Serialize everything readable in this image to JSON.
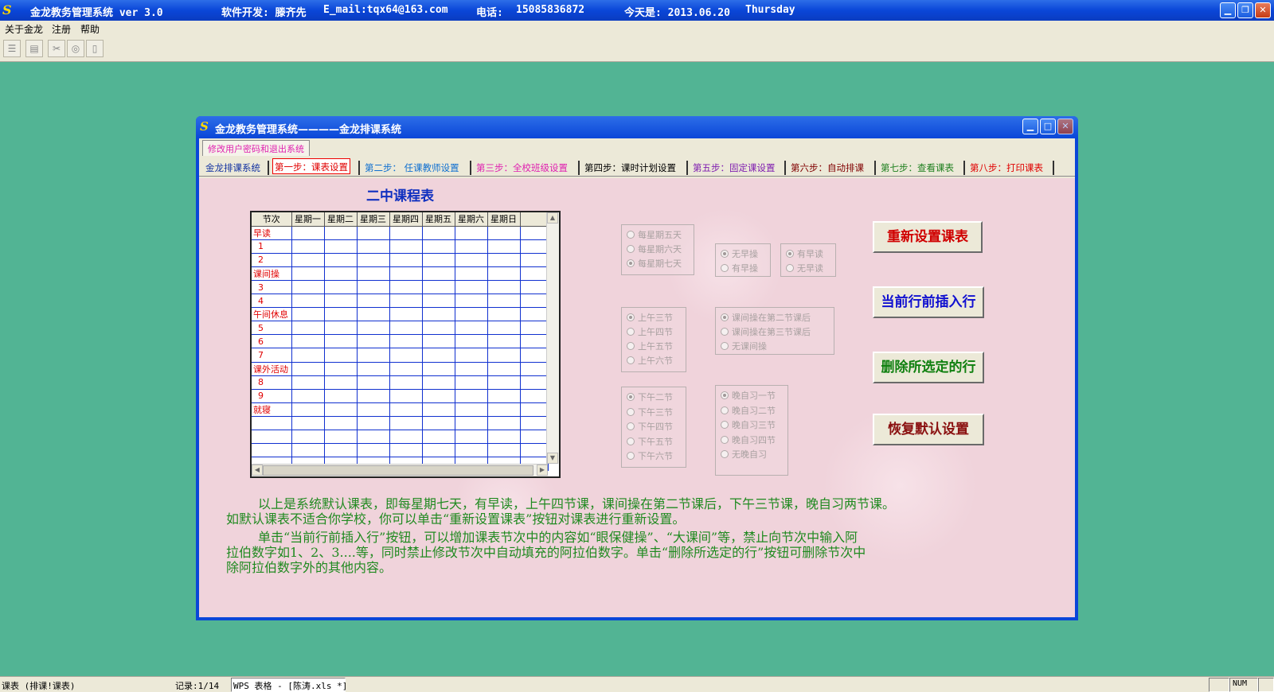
{
  "app": {
    "logo_letter": "S",
    "title": "金龙教务管理系统 ver 3.0",
    "developer": "软件开发: 滕齐先",
    "email": "E_mail:tqx64@163.com",
    "phone_label": "电话:",
    "phone": "15085836872",
    "date_label": "今天是: 2013.06.20",
    "weekday": "Thursday"
  },
  "menu": [
    "关于金龙",
    "注册",
    "帮助"
  ],
  "child_window": {
    "title": "金龙教务管理系统————金龙排课系统",
    "top_tab": "修改用户密码和退出系统",
    "tabs": [
      {
        "label": "金龙排课系统",
        "color": "#1030a0"
      },
      {
        "label": "第一步：课表设置",
        "color": "#e00000"
      },
      {
        "label": "第二步： 任课教师设置",
        "color": "#1070d0"
      },
      {
        "label": "第三步：全校班级设置",
        "color": "#e020b0"
      },
      {
        "label": "第四步：课时计划设置",
        "color": "#000000"
      },
      {
        "label": "第五步：固定课设置",
        "color": "#8020b0"
      },
      {
        "label": "第六步：自动排课",
        "color": "#800000"
      },
      {
        "label": "第七步：查看课表",
        "color": "#208020"
      },
      {
        "label": "第八步：打印课表",
        "color": "#e00000"
      }
    ]
  },
  "schedule": {
    "title": "二中课程表",
    "headers": [
      "节次",
      "星期一",
      "星期二",
      "星期三",
      "星期四",
      "星期五",
      "星期六",
      "星期日"
    ],
    "rows": [
      {
        "label": "早读",
        "type": "section"
      },
      {
        "label": "1",
        "type": "num"
      },
      {
        "label": "2",
        "type": "num"
      },
      {
        "label": "课间操",
        "type": "section"
      },
      {
        "label": "3",
        "type": "num"
      },
      {
        "label": "4",
        "type": "num"
      },
      {
        "label": "午间休息",
        "type": "section"
      },
      {
        "label": "5",
        "type": "num"
      },
      {
        "label": "6",
        "type": "num"
      },
      {
        "label": "7",
        "type": "num"
      },
      {
        "label": "课外活动",
        "type": "section"
      },
      {
        "label": "8",
        "type": "num"
      },
      {
        "label": "9",
        "type": "num"
      },
      {
        "label": "就寝",
        "type": "section"
      },
      {
        "label": "",
        "type": "empty"
      },
      {
        "label": "",
        "type": "empty"
      },
      {
        "label": "",
        "type": "empty"
      },
      {
        "label": "",
        "type": "empty"
      }
    ]
  },
  "options": {
    "days": [
      "每星期五天",
      "每星期六天",
      "每星期七天"
    ],
    "days_selected": 2,
    "exercise": [
      "无早操",
      "有早操"
    ],
    "exercise_selected": 0,
    "morning_read": [
      "有早读",
      "无早读"
    ],
    "morning_read_selected": 0,
    "morning": [
      "上午三节",
      "上午四节",
      "上午五节",
      "上午六节"
    ],
    "morning_selected": 0,
    "break": [
      "课间操在第二节课后",
      "课间操在第三节课后",
      "无课间操"
    ],
    "break_selected": 0,
    "afternoon": [
      "下午二节",
      "下午三节",
      "下午四节",
      "下午五节",
      "下午六节"
    ],
    "afternoon_selected": 0,
    "evening": [
      "晚自习一节",
      "晚自习二节",
      "晚自习三节",
      "晚自习四节",
      "无晚自习"
    ],
    "evening_selected": 0
  },
  "buttons": {
    "reset": "重新设置课表",
    "insert": "当前行前插入行",
    "delete": "删除所选定的行",
    "restore": "恢复默认设置"
  },
  "help_text": {
    "p1": "以上是系统默认课表，即每星期七天，有早读，上午四节课，课间操在第二节课后，下午三节课，晚自习两节课。",
    "p1b": "如默认课表不适合你学校，你可以单击“重新设置课表”按钮对课表进行重新设置。",
    "p2": "单击“当前行前插入行”按钮，可以增加课表节次中的内容如“眼保健操”、“大课间”等，禁止向节次中输入阿",
    "p2b": "拉伯数字如1、2、3....等，同时禁止修改节次中自动填充的阿拉伯数字。单击“删除所选定的行”按钮可删除节次中",
    "p2c": "除阿拉伯数字外的其他内容。"
  },
  "status": {
    "left": "课表 (排课!课表)",
    "record": "记录:1/14",
    "taskbar_item": "WPS 表格 - [陈涛.xls *]",
    "num": "NUM"
  }
}
